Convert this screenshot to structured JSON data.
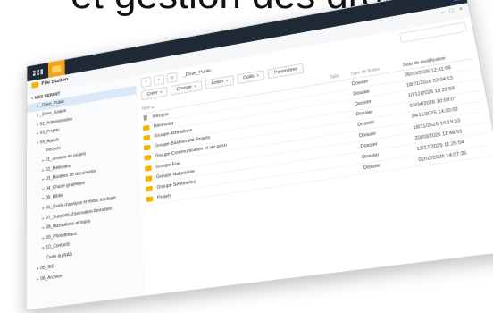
{
  "headline": "et gestion des droits",
  "app": {
    "title": "File Station"
  },
  "sidebar": {
    "items": [
      {
        "label": "NAS-SEPANT",
        "level": 0,
        "caret": "▾",
        "selected": false,
        "root": true
      },
      {
        "label": "_Drive_Public",
        "level": 1,
        "caret": "▸",
        "selected": true
      },
      {
        "label": "_Drive_Salarie",
        "level": 1,
        "caret": "▸",
        "selected": false
      },
      {
        "label": "02_Administration",
        "level": 1,
        "caret": "▸",
        "selected": false
      },
      {
        "label": "03_Projets",
        "level": 1,
        "caret": "▸",
        "selected": false
      },
      {
        "label": "04_Appuis",
        "level": 1,
        "caret": "▾",
        "selected": false
      },
      {
        "label": "#recycle",
        "level": 2,
        "caret": "",
        "selected": false
      },
      {
        "label": "01_Gestion de projets",
        "level": 2,
        "caret": "▸",
        "selected": false
      },
      {
        "label": "02_Méthodes",
        "level": 2,
        "caret": "▸",
        "selected": false
      },
      {
        "label": "03_Modèles de documents",
        "level": 2,
        "caret": "▸",
        "selected": false
      },
      {
        "label": "04_Charte graphique",
        "level": 2,
        "caret": "▸",
        "selected": false
      },
      {
        "label": "05_Biblio",
        "level": 2,
        "caret": "▸",
        "selected": false
      },
      {
        "label": "06_Outils d'analyse et rédac écologie",
        "level": 2,
        "caret": "▸",
        "selected": false
      },
      {
        "label": "07_Supports d'animation-formation",
        "level": 2,
        "caret": "▸",
        "selected": false
      },
      {
        "label": "08_Illustrations et logos",
        "level": 2,
        "caret": "▸",
        "selected": false
      },
      {
        "label": "09_Photothèque",
        "level": 2,
        "caret": "▸",
        "selected": false
      },
      {
        "label": "10_Contacts",
        "level": 2,
        "caret": "▸",
        "selected": false
      },
      {
        "label": "Carte du NAS",
        "level": 2,
        "caret": "",
        "selected": false
      },
      {
        "label": "05_SIG",
        "level": 1,
        "caret": "▸",
        "selected": false
      },
      {
        "label": "06_Archive",
        "level": 1,
        "caret": "▸",
        "selected": false
      }
    ]
  },
  "pathbar": {
    "back": "‹",
    "forward": "›",
    "refresh": "↻",
    "path": "_Drive_Public"
  },
  "toolbar": {
    "create": "Créer",
    "upload": "Charger",
    "action": "Action",
    "tools": "Outils",
    "settings": "Paramètres"
  },
  "columns": {
    "name": "Nom",
    "size": "Taille",
    "type": "Type de fichier",
    "date": "Date de modification"
  },
  "files": [
    {
      "name": "#recycle",
      "icon": "recycle-bin-icon",
      "type": "Dossier",
      "date": "26/03/2026 12:41:08"
    },
    {
      "name": "Bénévolat",
      "icon": "folder-icon",
      "type": "Dossier",
      "date": "18/01/2026 23:04:13"
    },
    {
      "name": "Groupe Animations",
      "icon": "folder-icon",
      "type": "Dossier",
      "date": "10/12/2025 19:22:59"
    },
    {
      "name": "Groupe Biodiversité-Projets",
      "icon": "folder-icon",
      "type": "Dossier",
      "date": "03/04/2026 10:09:07"
    },
    {
      "name": "Groupe Communication et vie asso",
      "icon": "folder-icon",
      "type": "Dossier",
      "date": "24/11/2025 14:30:02"
    },
    {
      "name": "Groupe Eau",
      "icon": "folder-icon",
      "type": "Dossier",
      "date": "18/11/2025 14:19:53"
    },
    {
      "name": "Groupe Naturaliste",
      "icon": "folder-icon",
      "type": "Dossier",
      "date": "20/03/2026 11:48:51"
    },
    {
      "name": "Groupe Sentinelles",
      "icon": "folder-icon",
      "type": "Dossier",
      "date": "13/12/2025 11:25:04"
    },
    {
      "name": "Projets",
      "icon": "folder-icon",
      "type": "Dossier",
      "date": "02/02/2026 14:07:35"
    }
  ],
  "colors": {
    "accent": "#f4b400",
    "selection": "#dbe8f7",
    "topbar": "#1f2a36"
  }
}
